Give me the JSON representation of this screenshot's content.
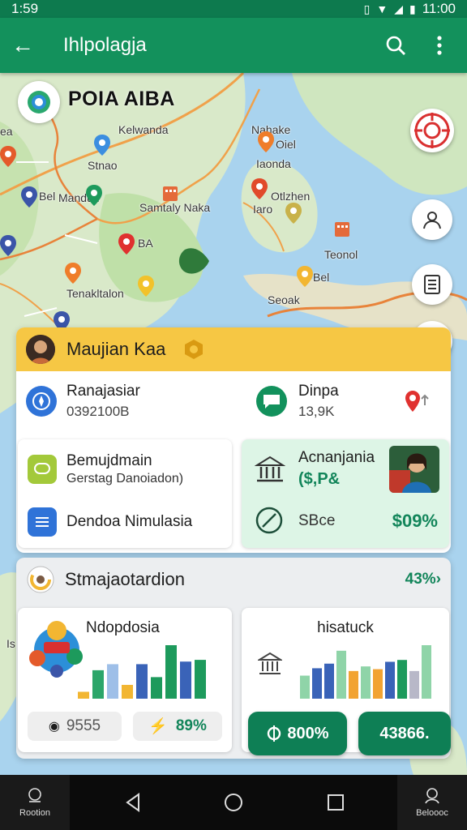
{
  "status": {
    "time": "1:59",
    "clock": "11:00"
  },
  "appbar": {
    "title": "Ihlpolagja"
  },
  "map": {
    "brand": "POIA AIBA",
    "places": [
      "Kelwanda",
      "Nahake",
      "Oiel",
      "Iaonda",
      "Stnao",
      "Samtaly Naka",
      "Otlzhen",
      "Bel",
      "Mandun",
      "Iaro",
      "BA",
      "Teonol",
      "Tenakltalon",
      "Bel",
      "Seoak",
      "ea"
    ]
  },
  "panel": {
    "header_name": "Maujian Kaa",
    "stat_left": {
      "label": "Ranajasiar",
      "value": "0392100B"
    },
    "stat_right": {
      "label": "Dinpa",
      "value": "13,9K"
    },
    "left_card": {
      "item1_title": "Bemujdmain",
      "item1_sub": "Gerstag Danoiadon)",
      "item2_title": "Dendoa Nimulasia"
    },
    "right_card": {
      "title": "Acnanjania",
      "value": "($,P&",
      "footer_label": "SBce",
      "footer_value": "$09%"
    }
  },
  "section2": {
    "title": "Stmajaotardion",
    "pct": "43%",
    "left_chart": {
      "title": "Ndopdosia",
      "chip1": "9555",
      "chip2": "89%"
    },
    "right_chart": {
      "title": "hisatuck",
      "btn1": "800%",
      "btn2": "43866."
    }
  },
  "navbar": {
    "left_label": "Rootion",
    "right_label": "Beloooc"
  },
  "side_label": "Is",
  "chart_data": [
    {
      "type": "bar",
      "title": "Ndopdosia",
      "categories": [
        "1",
        "2",
        "3",
        "4",
        "5",
        "6",
        "7",
        "8",
        "9"
      ],
      "values": [
        8,
        33,
        40,
        16,
        40,
        25,
        62,
        43,
        45
      ],
      "colors": [
        "#f2b632",
        "#2ca66a",
        "#9ebfe8",
        "#f2b632",
        "#3a63b8",
        "#1d9a5c",
        "#1d9a5c",
        "#3a63b8",
        "#1d9a5c"
      ]
    },
    {
      "type": "bar",
      "title": "hisatuck",
      "categories": [
        "1",
        "2",
        "3",
        "4",
        "5",
        "6",
        "7",
        "8",
        "9",
        "10",
        "11"
      ],
      "values": [
        25,
        33,
        38,
        52,
        30,
        35,
        32,
        40,
        42,
        30,
        58
      ],
      "colors": [
        "#8fd4a8",
        "#3a63b8",
        "#3a63b8",
        "#8fd4a8",
        "#f2a332",
        "#8fd4a8",
        "#f2a332",
        "#3a63b8",
        "#1d9a5c",
        "#b8b8c8",
        "#8fd4a8"
      ]
    }
  ]
}
